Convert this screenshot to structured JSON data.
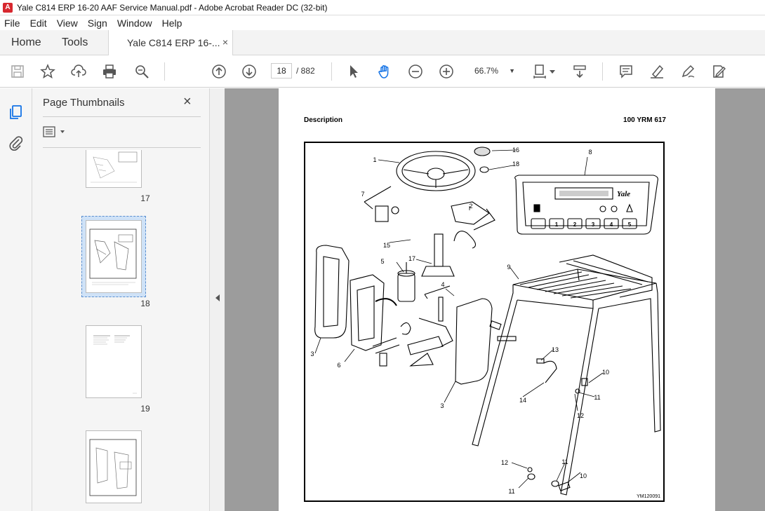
{
  "window": {
    "title": "Yale C814 ERP 16-20 AAF Service Manual.pdf - Adobe Acrobat Reader DC (32-bit)"
  },
  "menu": [
    "File",
    "Edit",
    "View",
    "Sign",
    "Window",
    "Help"
  ],
  "tabs": {
    "home": "Home",
    "tools": "Tools",
    "doc": "Yale C814 ERP 16-...",
    "close": "×"
  },
  "toolbar": {
    "page_current": "18",
    "page_total": "/ 882",
    "zoom": "66.7%"
  },
  "panel": {
    "title": "Page Thumbnails",
    "close": "×"
  },
  "thumbnails": [
    {
      "label": "17"
    },
    {
      "label": "18"
    },
    {
      "label": "19"
    },
    {
      "label": ""
    }
  ],
  "document": {
    "header_left": "Description",
    "header_right": "100 YRM 617",
    "figure_code": "YM120091",
    "brand": "Yale",
    "callouts": [
      "1",
      "2",
      "3",
      "4",
      "5",
      "6",
      "7",
      "8",
      "9",
      "10",
      "11",
      "12",
      "13",
      "14",
      "15",
      "16",
      "17",
      "18"
    ],
    "keypad": [
      "1",
      "2",
      "3",
      "4",
      "5"
    ]
  },
  "colors": {
    "accent": "#d7282f",
    "doc_bg": "#9c9c9c",
    "panel_bg": "#f5f5f5"
  }
}
